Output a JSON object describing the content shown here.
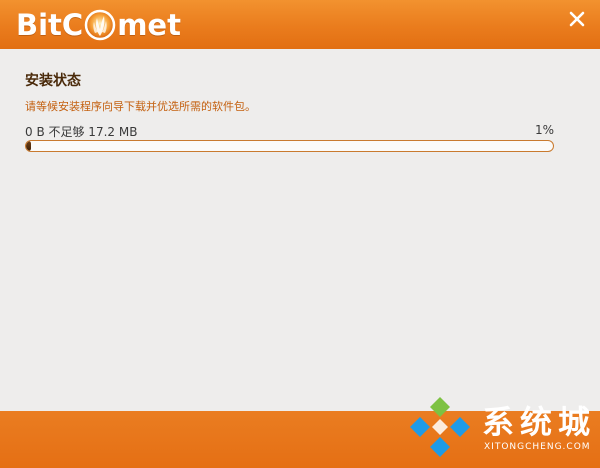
{
  "app": {
    "logo_left": "BitC",
    "logo_right": "met",
    "close_label": "✕"
  },
  "colors": {
    "header": "#ea7c1d",
    "footer": "#e56f14",
    "accent_text": "#c4600f",
    "progress_fill": "#4a2608",
    "progress_border": "#c97a2e"
  },
  "install": {
    "title": "安装状态",
    "description": "请等候安装程序向导下载并优选所需的软件包。",
    "progress_label": "0 B 不足够 17.2 MB",
    "progress_percent_text": "1%",
    "progress_value": 0.01
  },
  "watermark": {
    "text": "系统城",
    "subtext": "XITONGCHENG.COM"
  }
}
